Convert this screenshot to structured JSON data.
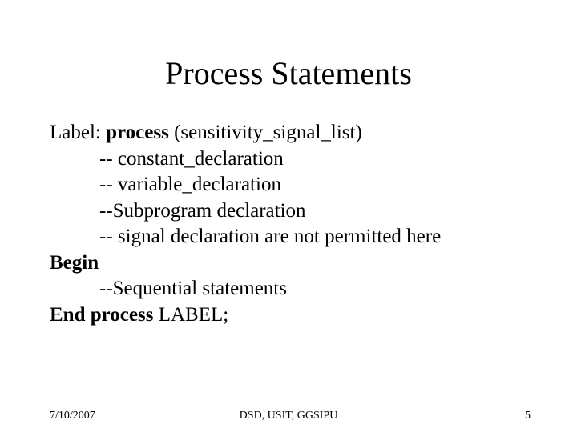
{
  "title": "Process Statements",
  "body": {
    "line1_prefix": " Label: ",
    "line1_bold": "process",
    "line1_suffix": " (sensitivity_signal_list)",
    "line2": "-- constant_declaration",
    "line3": "-- variable_declaration",
    "line4": "--Subprogram declaration",
    "line5": "-- signal declaration are not permitted here",
    "line6_bold": "Begin",
    "line7": "--Sequential statements",
    "line8_bold": "End process",
    "line8_suffix": " LABEL;"
  },
  "footer": {
    "date": "7/10/2007",
    "center": "DSD, USIT, GGSIPU",
    "page": "5"
  }
}
